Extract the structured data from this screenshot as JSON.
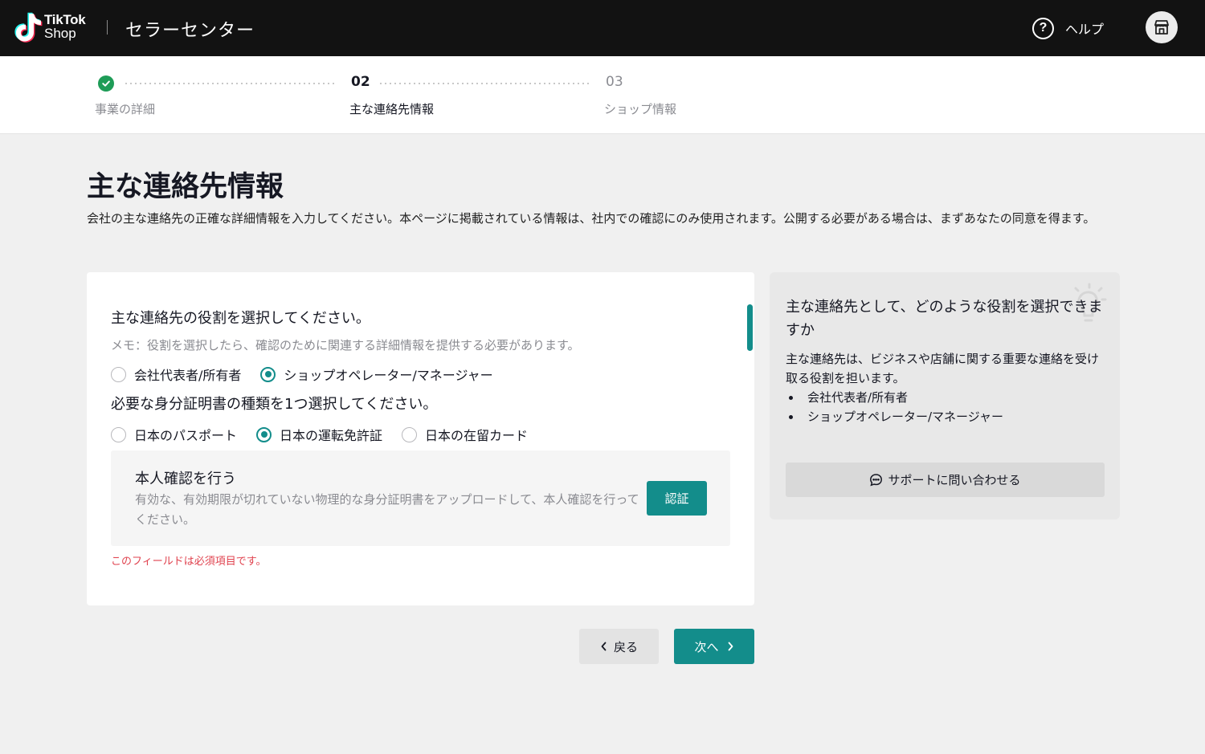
{
  "header": {
    "logo_line1": "TikTok",
    "logo_line2": "Shop",
    "title": "セラーセンター",
    "help_label": "ヘルプ",
    "help_icon": "question-circle-icon",
    "avatar_icon": "store-icon"
  },
  "stepper": {
    "steps": [
      {
        "number": "",
        "label": "事業の詳細",
        "state": "completed"
      },
      {
        "number": "02",
        "label": "主な連絡先情報",
        "state": "current"
      },
      {
        "number": "03",
        "label": "ショップ情報",
        "state": "upcoming"
      }
    ]
  },
  "page": {
    "title": "主な連絡先情報",
    "description": "会社の主な連絡先の正確な詳細情報を入力してください。本ページに掲載されている情報は、社内での確認にのみ使用されます。公開する必要がある場合は、まずあなたの同意を得ます。"
  },
  "form": {
    "role_question": "主な連絡先の役割を選択してください。",
    "role_note": "メモ：役割を選択したら、確認のために関連する詳細情報を提供する必要があります。",
    "role_options": [
      {
        "label": "会社代表者/所有者",
        "selected": false
      },
      {
        "label": "ショップオペレーター/マネージャー",
        "selected": true
      }
    ],
    "id_question": "必要な身分証明書の種類を1つ選択してください。",
    "id_options": [
      {
        "label": "日本のパスポート",
        "selected": false
      },
      {
        "label": "日本の運転免許証",
        "selected": true
      },
      {
        "label": "日本の在留カード",
        "selected": false
      }
    ],
    "verify": {
      "title": "本人確認を行う",
      "description": "有効な、有効期限が切れていない物理的な身分証明書をアップロードして、本人確認を行ってください。",
      "button_label": "認証"
    },
    "error": "このフィールドは必須項目です。"
  },
  "side_panel": {
    "title": "主な連絡先として、どのような役割を選択できますか",
    "body": "主な連絡先は、ビジネスや店舗に関する重要な連絡を受け取る役割を担います。",
    "roles": [
      "会社代表者/所有者",
      "ショップオペレーター/マネージャー"
    ],
    "support_label": "サポートに問い合わせる",
    "support_icon": "chat-bubble-icon",
    "decor_icon": "lightbulb-icon"
  },
  "footer": {
    "back_label": "戻る",
    "next_label": "次へ"
  },
  "colors": {
    "accent": "#138d8b",
    "header_bg": "#121212",
    "success": "#1e9c57",
    "error": "#e0434f",
    "page_bg": "#f0f0f0"
  }
}
